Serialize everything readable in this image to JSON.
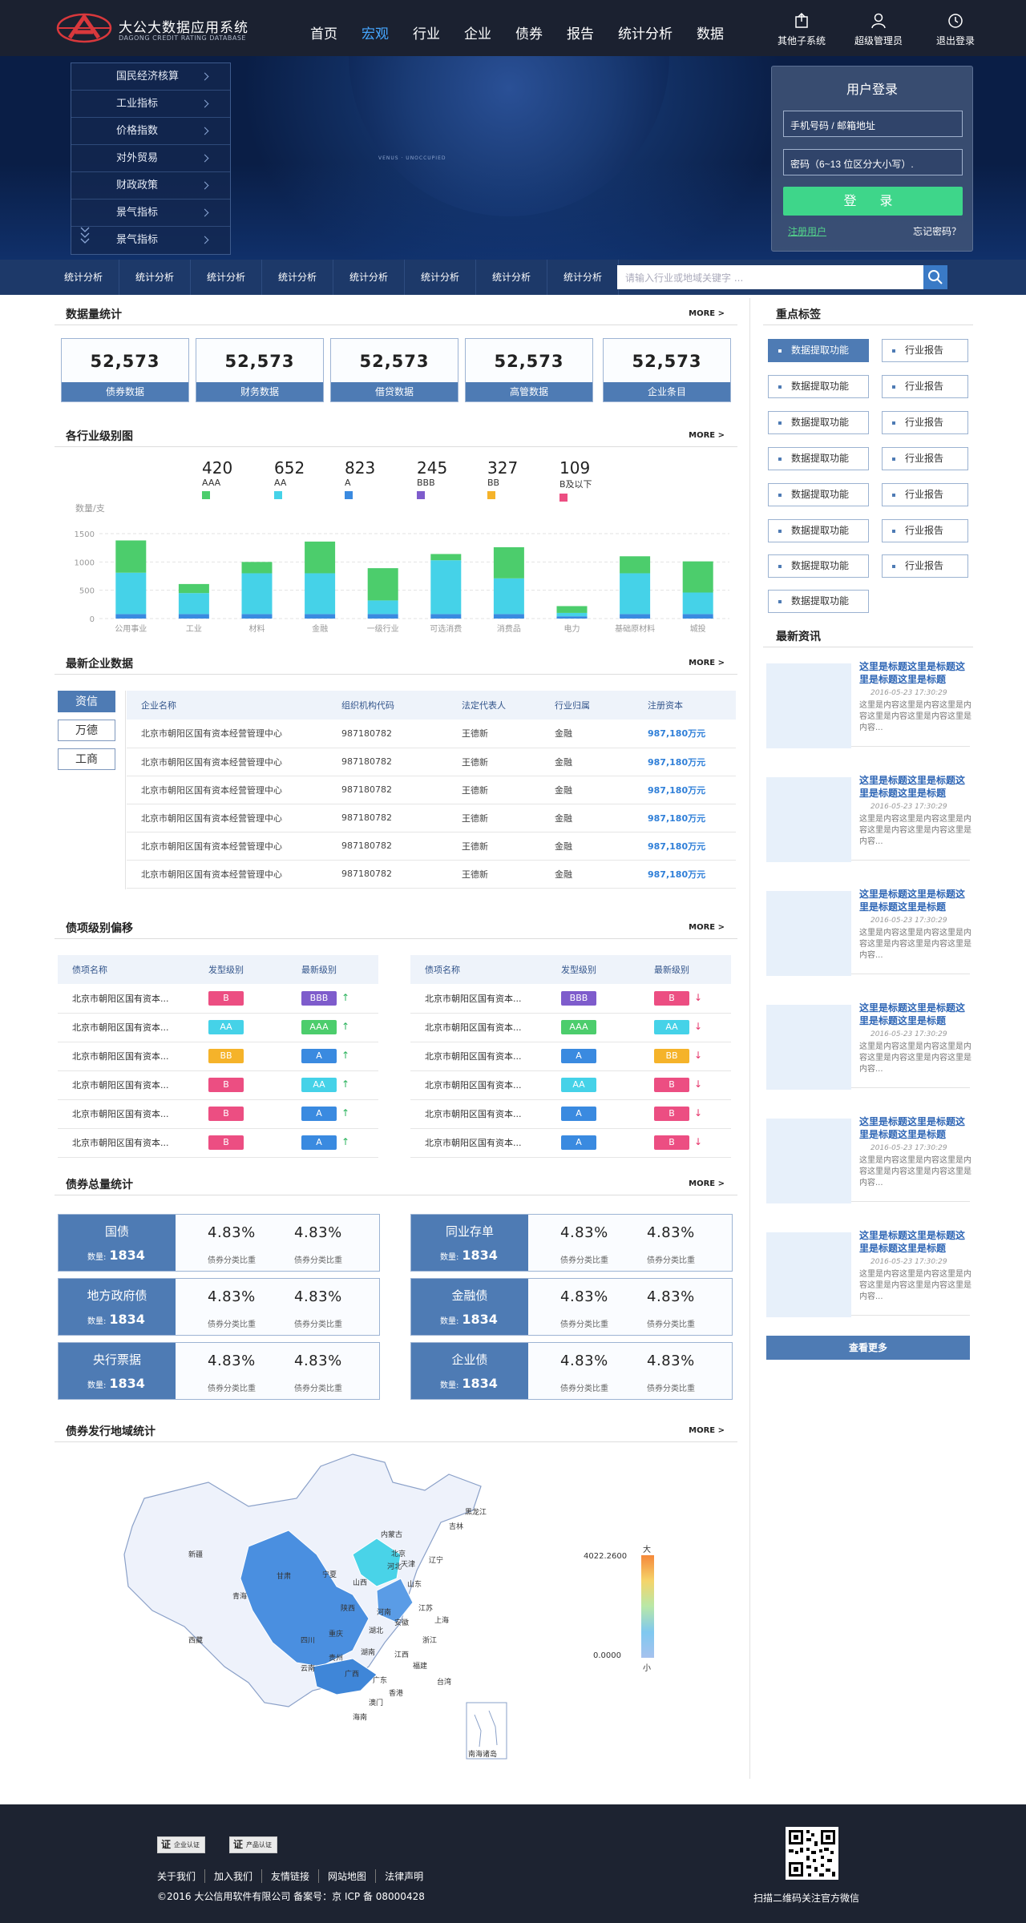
{
  "header": {
    "brand_cn": "大公大数据应用系统",
    "brand_en": "DAGONG CREDIT RATING DATABASE",
    "nav": [
      "首页",
      "宏观",
      "行业",
      "企业",
      "债券",
      "报告",
      "统计分析",
      "数据"
    ],
    "nav_active": "宏观",
    "tools": [
      {
        "label": "其他子系统",
        "icon": "export-icon"
      },
      {
        "label": "超级管理员",
        "icon": "user-icon"
      },
      {
        "label": "退出登录",
        "icon": "clock-icon"
      }
    ]
  },
  "hero": {
    "tagline": "VENUS · UNOCCUPIED",
    "menu": [
      "国民经济核算",
      "工业指标",
      "价格指数",
      "对外贸易",
      "财政政策",
      "景气指标",
      "景气指标"
    ]
  },
  "login": {
    "title": "用户登录",
    "phone_placeholder": "手机号码 / 邮箱地址",
    "password_placeholder": "密码（6~13 位区分大小写）.",
    "submit": "登 录",
    "register": "注册用户",
    "forgot": "忘记密码？"
  },
  "subnav": {
    "items": [
      "统计分析",
      "统计分析",
      "统计分析",
      "统计分析",
      "统计分析",
      "统计分析",
      "统计分析",
      "统计分析"
    ],
    "search_placeholder": "请输入行业或地域关键字 ..."
  },
  "sections": {
    "data_stats": "数据量统计",
    "industry": "各行业级别图",
    "latest_companies": "最新企业数据",
    "bond_shift": "债项级别偏移",
    "bond_total": "债券总量统计",
    "bond_region": "债券发行地域统计",
    "tags": "重点标签",
    "news": "最新资讯",
    "more": "MORE >"
  },
  "stats": [
    {
      "value": "52,573",
      "label": "债券数据"
    },
    {
      "value": "52,573",
      "label": "财务数据"
    },
    {
      "value": "52,573",
      "label": "借贷数据"
    },
    {
      "value": "52,573",
      "label": "高管数据"
    },
    {
      "value": "52,573",
      "label": "企业条目"
    }
  ],
  "ratings": [
    {
      "value": "420",
      "grade": "AAA",
      "color": "#4ccd6c"
    },
    {
      "value": "652",
      "grade": "AA",
      "color": "#45d2e8"
    },
    {
      "value": "823",
      "grade": "A",
      "color": "#3a8ae0"
    },
    {
      "value": "245",
      "grade": "BBB",
      "color": "#7e5ccc"
    },
    {
      "value": "327",
      "grade": "BB",
      "color": "#f5b32a"
    },
    {
      "value": "109",
      "grade": "B及以下",
      "color": "#ec4e82"
    }
  ],
  "chart_data": {
    "type": "bar",
    "ylabel": "数量/支",
    "ylim": [
      0,
      1500
    ],
    "yticks": [
      0,
      500,
      1000,
      1500
    ],
    "categories": [
      "公用事业",
      "工业",
      "材料",
      "金融",
      "一级行业",
      "可选消费",
      "消费品",
      "电力",
      "基础原材料",
      "城投"
    ],
    "series": [
      {
        "color": "#3a8ae0",
        "values": [
          80,
          80,
          80,
          80,
          80,
          80,
          80,
          40,
          80,
          80
        ]
      },
      {
        "color": "#45d2e8",
        "values": [
          730,
          370,
          720,
          720,
          240,
          950,
          630,
          60,
          720,
          380
        ]
      },
      {
        "color": "#4ccd6c",
        "values": [
          570,
          160,
          200,
          560,
          570,
          110,
          550,
          120,
          300,
          550
        ]
      }
    ]
  },
  "company_table": {
    "tabs": [
      "资信",
      "万德",
      "工商"
    ],
    "active_tab": "资信",
    "headers": [
      "企业名称",
      "组织机构代码",
      "法定代表人",
      "行业归属",
      "注册资本"
    ],
    "rows": [
      [
        "北京市朝阳区国有资本经营管理中心",
        "987180782",
        "王德新",
        "金融",
        "987,180万元"
      ],
      [
        "北京市朝阳区国有资本经营管理中心",
        "987180782",
        "王德新",
        "金融",
        "987,180万元"
      ],
      [
        "北京市朝阳区国有资本经营管理中心",
        "987180782",
        "王德新",
        "金融",
        "987,180万元"
      ],
      [
        "北京市朝阳区国有资本经营管理中心",
        "987180782",
        "王德新",
        "金融",
        "987,180万元"
      ],
      [
        "北京市朝阳区国有资本经营管理中心",
        "987180782",
        "王德新",
        "金融",
        "987,180万元"
      ],
      [
        "北京市朝阳区国有资本经营管理中心",
        "987180782",
        "王德新",
        "金融",
        "987,180万元"
      ]
    ]
  },
  "bond_shift": {
    "headers": [
      "债项名称",
      "发型级别",
      "最新级别"
    ],
    "left": [
      {
        "name": "北京市朝阳区国有资本...",
        "from": "B",
        "from_color": "#ec4e82",
        "to": "BBB",
        "to_color": "#7e5ccc",
        "dir": "↑"
      },
      {
        "name": "北京市朝阳区国有资本...",
        "from": "AA",
        "from_color": "#45d2e8",
        "to": "AAA",
        "to_color": "#4ccd6c",
        "dir": "↑"
      },
      {
        "name": "北京市朝阳区国有资本...",
        "from": "BB",
        "from_color": "#f5b32a",
        "to": "A",
        "to_color": "#3a8ae0",
        "dir": "↑"
      },
      {
        "name": "北京市朝阳区国有资本...",
        "from": "B",
        "from_color": "#ec4e82",
        "to": "AA",
        "to_color": "#45d2e8",
        "dir": "↑"
      },
      {
        "name": "北京市朝阳区国有资本...",
        "from": "B",
        "from_color": "#ec4e82",
        "to": "A",
        "to_color": "#3a8ae0",
        "dir": "↑"
      },
      {
        "name": "北京市朝阳区国有资本...",
        "from": "B",
        "from_color": "#ec4e82",
        "to": "A",
        "to_color": "#3a8ae0",
        "dir": "↑"
      }
    ],
    "right": [
      {
        "name": "北京市朝阳区国有资本...",
        "from": "BBB",
        "from_color": "#7e5ccc",
        "to": "B",
        "to_color": "#ec4e82",
        "dir": "↓"
      },
      {
        "name": "北京市朝阳区国有资本...",
        "from": "AAA",
        "from_color": "#4ccd6c",
        "to": "AA",
        "to_color": "#45d2e8",
        "dir": "↓"
      },
      {
        "name": "北京市朝阳区国有资本...",
        "from": "A",
        "from_color": "#3a8ae0",
        "to": "BB",
        "to_color": "#f5b32a",
        "dir": "↓"
      },
      {
        "name": "北京市朝阳区国有资本...",
        "from": "AA",
        "from_color": "#45d2e8",
        "to": "B",
        "to_color": "#ec4e82",
        "dir": "↓"
      },
      {
        "name": "北京市朝阳区国有资本...",
        "from": "A",
        "from_color": "#3a8ae0",
        "to": "B",
        "to_color": "#ec4e82",
        "dir": "↓"
      },
      {
        "name": "北京市朝阳区国有资本...",
        "from": "A",
        "from_color": "#3a8ae0",
        "to": "B",
        "to_color": "#ec4e82",
        "dir": "↓"
      }
    ]
  },
  "bond_totals": [
    {
      "name": "国债",
      "count_label": "数量:",
      "count": "1834",
      "p1": "4.83%",
      "p2": "4.83%",
      "pl": "债券分类比重"
    },
    {
      "name": "同业存单",
      "count_label": "数量:",
      "count": "1834",
      "p1": "4.83%",
      "p2": "4.83%",
      "pl": "债券分类比重"
    },
    {
      "name": "地方政府债",
      "count_label": "数量:",
      "count": "1834",
      "p1": "4.83%",
      "p2": "4.83%",
      "pl": "债券分类比重"
    },
    {
      "name": "金融债",
      "count_label": "数量:",
      "count": "1834",
      "p1": "4.83%",
      "p2": "4.83%",
      "pl": "债券分类比重"
    },
    {
      "name": "央行票据",
      "count_label": "数量:",
      "count": "1834",
      "p1": "4.83%",
      "p2": "4.83%",
      "pl": "债券分类比重"
    },
    {
      "name": "企业债",
      "count_label": "数量:",
      "count": "1834",
      "p1": "4.83%",
      "p2": "4.83%",
      "pl": "债券分类比重"
    }
  ],
  "map": {
    "legend_max": "4022.2600",
    "legend_min": "0.0000",
    "legend_high": "大",
    "legend_low": "小",
    "provinces": [
      "黑龙江",
      "吉林",
      "辽宁",
      "内蒙古",
      "新疆",
      "西藏",
      "青海",
      "甘肃",
      "宁夏",
      "山西",
      "河北",
      "北京",
      "天津",
      "山东",
      "河南",
      "陕西",
      "四川",
      "重庆",
      "湖北",
      "安徽",
      "江苏",
      "上海",
      "浙江",
      "湖南",
      "江西",
      "福建",
      "贵州",
      "云南",
      "广西",
      "广东",
      "澳门",
      "香港",
      "台湾",
      "海南"
    ],
    "inset": "南海诸岛"
  },
  "tags": [
    {
      "label": "数据提取功能",
      "active": true
    },
    {
      "label": "行业报告",
      "active": false
    },
    {
      "label": "数据提取功能",
      "active": false
    },
    {
      "label": "行业报告",
      "active": false
    },
    {
      "label": "数据提取功能",
      "active": false
    },
    {
      "label": "行业报告",
      "active": false
    },
    {
      "label": "数据提取功能",
      "active": false
    },
    {
      "label": "行业报告",
      "active": false
    },
    {
      "label": "数据提取功能",
      "active": false
    },
    {
      "label": "行业报告",
      "active": false
    },
    {
      "label": "数据提取功能",
      "active": false
    },
    {
      "label": "行业报告",
      "active": false
    },
    {
      "label": "数据提取功能",
      "active": false
    },
    {
      "label": "行业报告",
      "active": false
    },
    {
      "label": "数据提取功能",
      "active": false
    }
  ],
  "news": [
    {
      "title": "这里是标题这里是标题这里是标题这里是标题",
      "date": "2016-05-23    17:30:29",
      "desc": "这里是内容这里是内容这里是内容这里是内容这里是内容这里是内容..."
    },
    {
      "title": "这里是标题这里是标题这里是标题这里是标题",
      "date": "2016-05-23    17:30:29",
      "desc": "这里是内容这里是内容这里是内容这里是内容这里是内容这里是内容..."
    },
    {
      "title": "这里是标题这里是标题这里是标题这里是标题",
      "date": "2016-05-23    17:30:29",
      "desc": "这里是内容这里是内容这里是内容这里是内容这里是内容这里是内容..."
    },
    {
      "title": "这里是标题这里是标题这里是标题这里是标题",
      "date": "2016-05-23    17:30:29",
      "desc": "这里是内容这里是内容这里是内容这里是内容这里是内容这里是内容..."
    },
    {
      "title": "这里是标题这里是标题这里是标题这里是标题",
      "date": "2016-05-23    17:30:29",
      "desc": "这里是内容这里是内容这里是内容这里是内容这里是内容这里是内容..."
    },
    {
      "title": "这里是标题这里是标题这里是标题这里是标题",
      "date": "2016-05-23    17:30:29",
      "desc": "这里是内容这里是内容这里是内容这里是内容这里是内容这里是内容..."
    }
  ],
  "news_more": "查看更多",
  "footer": {
    "cert1_mark": "证",
    "cert1": "企业认证",
    "cert2_mark": "证",
    "cert2": "产品认证",
    "links": [
      "关于我们",
      "加入我们",
      "友情链接",
      "网站地图",
      "法律声明"
    ],
    "copyright": "©2016 大公信用软件有限公司 备案号：京 ICP 备 08000428",
    "qr_label": "扫描二维码关注官方微信"
  }
}
